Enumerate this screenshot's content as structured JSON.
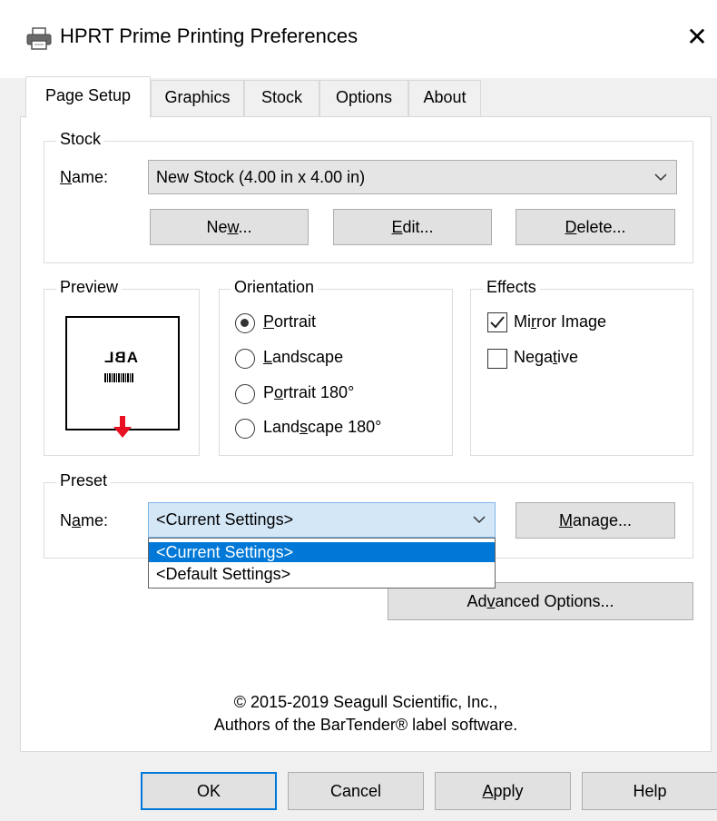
{
  "window": {
    "title": "HPRT Prime Printing Preferences",
    "close_label": "✕"
  },
  "tabs": [
    {
      "label": "Page Setup"
    },
    {
      "label": "Graphics"
    },
    {
      "label": "Stock"
    },
    {
      "label": "Options"
    },
    {
      "label": "About"
    }
  ],
  "stock": {
    "group_label": "Stock",
    "name_label": "Name:",
    "name_value": "New Stock (4.00 in x 4.00 in)",
    "new_button": "New...",
    "edit_button": "Edit...",
    "delete_button": "Delete..."
  },
  "preview": {
    "group_label": "Preview",
    "sample_text": "ABL",
    "accent_color": "#e81123"
  },
  "orientation": {
    "group_label": "Orientation",
    "options": [
      {
        "label": "Portrait",
        "selected": true
      },
      {
        "label": "Landscape",
        "selected": false
      },
      {
        "label": "Portrait 180°",
        "selected": false
      },
      {
        "label": "Landscape 180°",
        "selected": false
      }
    ]
  },
  "effects": {
    "group_label": "Effects",
    "mirror_image": {
      "label": "Mirror Image",
      "checked": true
    },
    "negative": {
      "label": "Negative",
      "checked": false
    }
  },
  "preset": {
    "group_label": "Preset",
    "name_label": "Name:",
    "name_value": "<Current Settings>",
    "manage_button": "Manage...",
    "dropdown_options": [
      {
        "label": "<Current Settings>",
        "highlighted": true
      },
      {
        "label": "<Default Settings>",
        "highlighted": false
      }
    ]
  },
  "advanced_button": "Advanced Options...",
  "copyright": {
    "line1": "© 2015-2019 Seagull Scientific, Inc.,",
    "line2": "Authors of the BarTender® label software."
  },
  "buttons": {
    "ok": "OK",
    "cancel": "Cancel",
    "apply": "Apply",
    "help": "Help"
  },
  "colors": {
    "focus_blue": "#0078d7",
    "dialog_bg": "#f0f0f0"
  }
}
